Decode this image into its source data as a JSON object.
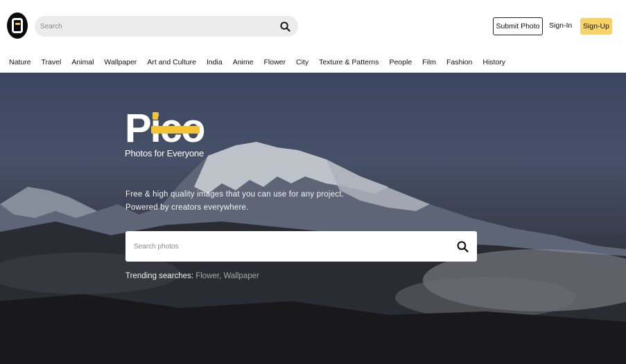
{
  "header": {
    "logo_icon": "pico-logo-icon",
    "search": {
      "placeholder": "Search",
      "icon": "search-icon"
    },
    "submit_label": "Submit Photo",
    "signin_label": "Sign-In",
    "signup_label": "Sign-Up"
  },
  "nav": {
    "items": [
      "Nature",
      "Travel",
      "Animal",
      "Wallpaper",
      "Art and Culture",
      "India",
      "Anime",
      "Flower",
      "City",
      "Texture & Patterns",
      "People",
      "Film",
      "Fashion",
      "History"
    ]
  },
  "hero": {
    "brand": "Pico",
    "tagline": "Photos for Everyone",
    "desc_line1": "Free & high quality images that you can use for any project.",
    "desc_line2": "Powered by creators everywhere.",
    "search_placeholder": "Search photos",
    "trending_label": "Trending searches:",
    "trending_items": [
      "Flower",
      "Wallpaper"
    ]
  },
  "colors": {
    "accent": "#f4c430",
    "signup_bg": "#f7d36a",
    "search_bg": "#ececec"
  }
}
